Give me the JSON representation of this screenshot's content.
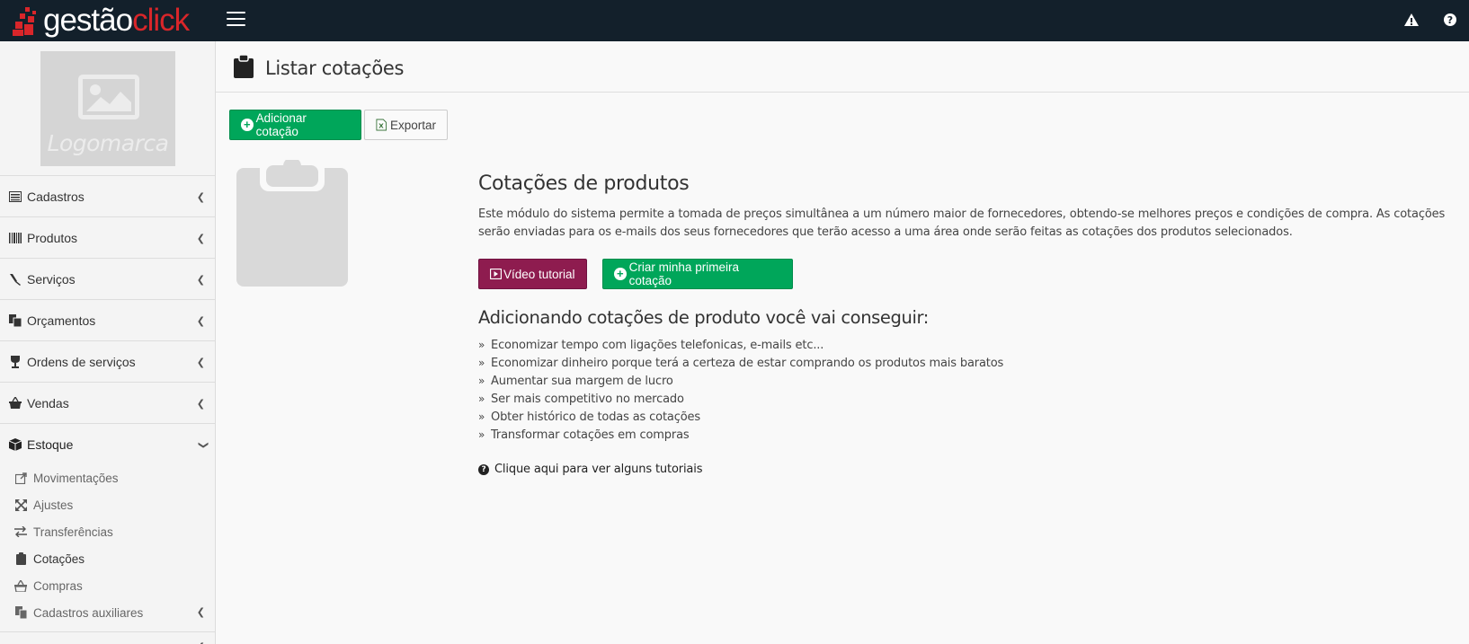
{
  "brand": {
    "logo_part1": "gestão",
    "logo_part2": "click"
  },
  "sidebar": {
    "logo_placeholder": "Logomarca",
    "items": [
      {
        "label": "Cadastros",
        "icon": "list-icon"
      },
      {
        "label": "Produtos",
        "icon": "barcode-icon"
      },
      {
        "label": "Serviços",
        "icon": "screwdriver-icon"
      },
      {
        "label": "Orçamentos",
        "icon": "copy-icon"
      },
      {
        "label": "Ordens de serviços",
        "icon": "wine-glass-icon"
      },
      {
        "label": "Vendas",
        "icon": "basket-icon"
      },
      {
        "label": "Estoque",
        "icon": "cube-icon"
      }
    ],
    "stock_submenu": [
      {
        "label": "Movimentações",
        "icon": "external-link-icon"
      },
      {
        "label": "Ajustes",
        "icon": "arrows-expand-icon"
      },
      {
        "label": "Transferências",
        "icon": "exchange-icon"
      },
      {
        "label": "Cotações",
        "icon": "clipboard-icon"
      },
      {
        "label": "Compras",
        "icon": "basket-icon"
      },
      {
        "label": "Cadastros auxiliares",
        "icon": "copy-icon"
      }
    ]
  },
  "header": {
    "title": "Listar cotações"
  },
  "toolbar": {
    "add_label": "Adicionar cotação",
    "export_label": "Exportar"
  },
  "main": {
    "heading": "Cotações de produtos",
    "description": "Este módulo do sistema permite a tomada de preços simultânea a um número maior de fornecedores, obtendo-se melhores preços e condições de compra. As cotações serão enviadas para os e-mails dos seus fornecedores que terão acesso a uma área onde serão feitas as cotações dos produtos selecionados.",
    "video_button": "Vídeo tutorial",
    "create_button": "Criar minha primeira cotação",
    "benefits_heading": "Adicionando cotações de produto você vai conseguir:",
    "benefits": [
      "Economizar tempo com ligações telefonicas, e-mails etc...",
      "Economizar dinheiro porque terá a certeza de estar comprando os produtos mais baratos",
      "Aumentar sua margem de lucro",
      "Ser mais competitivo no mercado",
      "Obter histórico de todas as cotações",
      "Transformar cotações em compras"
    ],
    "tutorial_link": "Clique aqui para ver alguns tutoriais"
  },
  "colors": {
    "topbar": "#13202b",
    "brand_red": "#d9262a",
    "green": "#00a65a",
    "maroon": "#8e1c4f"
  }
}
